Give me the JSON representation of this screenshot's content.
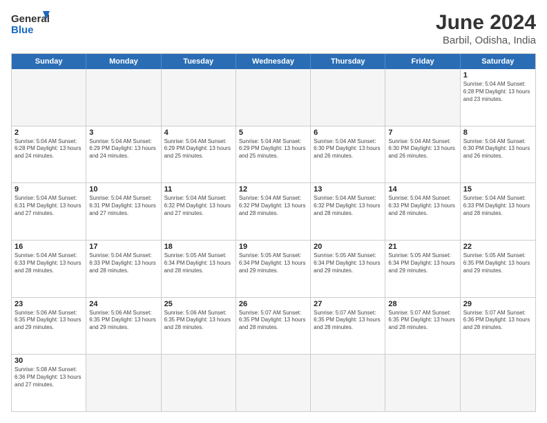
{
  "logo": {
    "text_general": "General",
    "text_blue": "Blue"
  },
  "header": {
    "month": "June 2024",
    "location": "Barbil, Odisha, India"
  },
  "days": [
    "Sunday",
    "Monday",
    "Tuesday",
    "Wednesday",
    "Thursday",
    "Friday",
    "Saturday"
  ],
  "weeks": [
    [
      {
        "day": "",
        "info": ""
      },
      {
        "day": "",
        "info": ""
      },
      {
        "day": "",
        "info": ""
      },
      {
        "day": "",
        "info": ""
      },
      {
        "day": "",
        "info": ""
      },
      {
        "day": "",
        "info": ""
      },
      {
        "day": "1",
        "info": "Sunrise: 5:04 AM\nSunset: 6:28 PM\nDaylight: 13 hours and 23 minutes."
      }
    ],
    [
      {
        "day": "2",
        "info": "Sunrise: 5:04 AM\nSunset: 6:28 PM\nDaylight: 13 hours and 24 minutes."
      },
      {
        "day": "3",
        "info": "Sunrise: 5:04 AM\nSunset: 6:29 PM\nDaylight: 13 hours and 24 minutes."
      },
      {
        "day": "4",
        "info": "Sunrise: 5:04 AM\nSunset: 6:29 PM\nDaylight: 13 hours and 25 minutes."
      },
      {
        "day": "5",
        "info": "Sunrise: 5:04 AM\nSunset: 6:29 PM\nDaylight: 13 hours and 25 minutes."
      },
      {
        "day": "6",
        "info": "Sunrise: 5:04 AM\nSunset: 6:30 PM\nDaylight: 13 hours and 26 minutes."
      },
      {
        "day": "7",
        "info": "Sunrise: 5:04 AM\nSunset: 6:30 PM\nDaylight: 13 hours and 26 minutes."
      },
      {
        "day": "8",
        "info": "Sunrise: 5:04 AM\nSunset: 6:30 PM\nDaylight: 13 hours and 26 minutes."
      }
    ],
    [
      {
        "day": "9",
        "info": "Sunrise: 5:04 AM\nSunset: 6:31 PM\nDaylight: 13 hours and 27 minutes."
      },
      {
        "day": "10",
        "info": "Sunrise: 5:04 AM\nSunset: 6:31 PM\nDaylight: 13 hours and 27 minutes."
      },
      {
        "day": "11",
        "info": "Sunrise: 5:04 AM\nSunset: 6:32 PM\nDaylight: 13 hours and 27 minutes."
      },
      {
        "day": "12",
        "info": "Sunrise: 5:04 AM\nSunset: 6:32 PM\nDaylight: 13 hours and 28 minutes."
      },
      {
        "day": "13",
        "info": "Sunrise: 5:04 AM\nSunset: 6:32 PM\nDaylight: 13 hours and 28 minutes."
      },
      {
        "day": "14",
        "info": "Sunrise: 5:04 AM\nSunset: 6:33 PM\nDaylight: 13 hours and 28 minutes."
      },
      {
        "day": "15",
        "info": "Sunrise: 5:04 AM\nSunset: 6:33 PM\nDaylight: 13 hours and 28 minutes."
      }
    ],
    [
      {
        "day": "16",
        "info": "Sunrise: 5:04 AM\nSunset: 6:33 PM\nDaylight: 13 hours and 28 minutes."
      },
      {
        "day": "17",
        "info": "Sunrise: 5:04 AM\nSunset: 6:33 PM\nDaylight: 13 hours and 28 minutes."
      },
      {
        "day": "18",
        "info": "Sunrise: 5:05 AM\nSunset: 6:34 PM\nDaylight: 13 hours and 28 minutes."
      },
      {
        "day": "19",
        "info": "Sunrise: 5:05 AM\nSunset: 6:34 PM\nDaylight: 13 hours and 29 minutes."
      },
      {
        "day": "20",
        "info": "Sunrise: 5:05 AM\nSunset: 6:34 PM\nDaylight: 13 hours and 29 minutes."
      },
      {
        "day": "21",
        "info": "Sunrise: 5:05 AM\nSunset: 6:34 PM\nDaylight: 13 hours and 29 minutes."
      },
      {
        "day": "22",
        "info": "Sunrise: 5:05 AM\nSunset: 6:35 PM\nDaylight: 13 hours and 29 minutes."
      }
    ],
    [
      {
        "day": "23",
        "info": "Sunrise: 5:06 AM\nSunset: 6:35 PM\nDaylight: 13 hours and 29 minutes."
      },
      {
        "day": "24",
        "info": "Sunrise: 5:06 AM\nSunset: 6:35 PM\nDaylight: 13 hours and 29 minutes."
      },
      {
        "day": "25",
        "info": "Sunrise: 5:06 AM\nSunset: 6:35 PM\nDaylight: 13 hours and 28 minutes."
      },
      {
        "day": "26",
        "info": "Sunrise: 5:07 AM\nSunset: 6:35 PM\nDaylight: 13 hours and 28 minutes."
      },
      {
        "day": "27",
        "info": "Sunrise: 5:07 AM\nSunset: 6:35 PM\nDaylight: 13 hours and 28 minutes."
      },
      {
        "day": "28",
        "info": "Sunrise: 5:07 AM\nSunset: 6:35 PM\nDaylight: 13 hours and 28 minutes."
      },
      {
        "day": "29",
        "info": "Sunrise: 5:07 AM\nSunset: 6:36 PM\nDaylight: 13 hours and 28 minutes."
      }
    ],
    [
      {
        "day": "30",
        "info": "Sunrise: 5:08 AM\nSunset: 6:36 PM\nDaylight: 13 hours and 27 minutes."
      },
      {
        "day": "",
        "info": ""
      },
      {
        "day": "",
        "info": ""
      },
      {
        "day": "",
        "info": ""
      },
      {
        "day": "",
        "info": ""
      },
      {
        "day": "",
        "info": ""
      },
      {
        "day": "",
        "info": ""
      }
    ]
  ]
}
